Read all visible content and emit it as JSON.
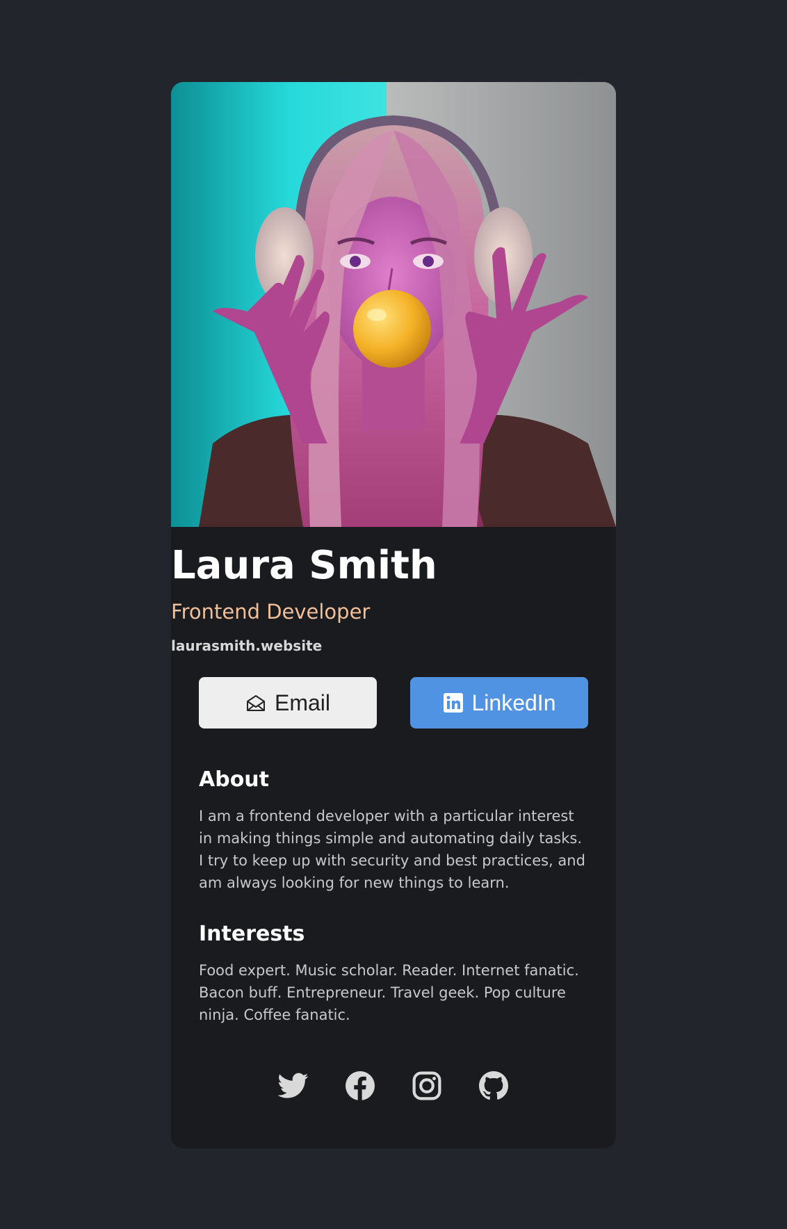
{
  "profile": {
    "name": "Laura Smith",
    "role": "Frontend Developer",
    "website": "laurasmith.website"
  },
  "buttons": {
    "email_label": "Email",
    "linkedin_label": "LinkedIn"
  },
  "about": {
    "title": "About",
    "text": "I am a frontend developer with a particular interest in making things simple and automating daily tasks. I try to keep up with security and best practices, and am always looking for new things to learn."
  },
  "interests": {
    "title": "Interests",
    "text": "Food expert. Music scholar. Reader. Internet fanatic. Bacon buff. Entrepreneur. Travel geek. Pop culture ninja. Coffee fanatic."
  },
  "socials": [
    {
      "icon": "twitter-icon"
    },
    {
      "icon": "facebook-icon"
    },
    {
      "icon": "instagram-icon"
    },
    {
      "icon": "github-icon"
    }
  ],
  "colors": {
    "page_background": "#23252c",
    "card_background": "#1a1b1f",
    "role_accent": "#f3bf99",
    "linkedin_blue": "#5093e2",
    "email_button": "#eeeeee"
  }
}
